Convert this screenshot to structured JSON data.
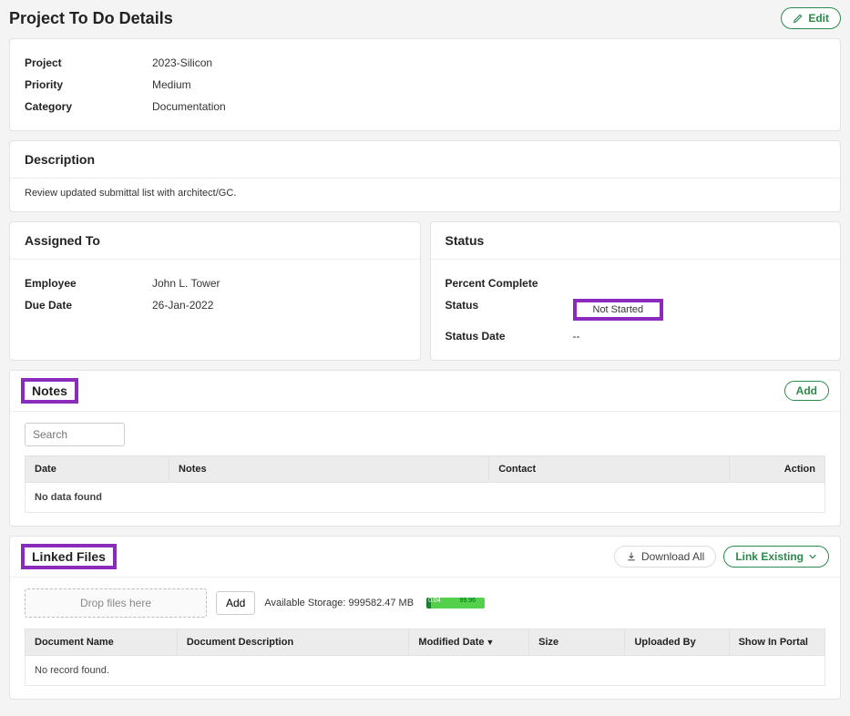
{
  "header": {
    "title": "Project To Do Details",
    "edit_label": "Edit"
  },
  "details": {
    "rows": [
      {
        "label": "Project",
        "value": "2023-Silicon"
      },
      {
        "label": "Priority",
        "value": "Medium"
      },
      {
        "label": "Category",
        "value": "Documentation"
      }
    ]
  },
  "description": {
    "heading": "Description",
    "text": "Review updated submittal list with architect/GC."
  },
  "assigned": {
    "heading": "Assigned To",
    "rows": [
      {
        "label": "Employee",
        "value": "John L. Tower"
      },
      {
        "label": "Due Date",
        "value": "26-Jan-2022"
      }
    ]
  },
  "status": {
    "heading": "Status",
    "rows": [
      {
        "label": "Percent Complete",
        "value": ""
      },
      {
        "label": "Status",
        "value": "Not Started"
      },
      {
        "label": "Status Date",
        "value": "--"
      }
    ]
  },
  "notes": {
    "heading": "Notes",
    "add_label": "Add",
    "search_placeholder": "Search",
    "columns": {
      "date": "Date",
      "notes": "Notes",
      "contact": "Contact",
      "action": "Action"
    },
    "empty": "No data found"
  },
  "linked": {
    "heading": "Linked Files",
    "download_label": "Download All",
    "link_existing_label": "Link Existing",
    "drop_text": "Drop files here",
    "add_label": "Add",
    "storage_label": "Available Storage: 999582.47 MB",
    "columns": {
      "name": "Document Name",
      "desc": "Document Description",
      "modified": "Modified Date",
      "size": "Size",
      "uploaded": "Uploaded By",
      "portal": "Show In Portal"
    },
    "empty": "No record found."
  }
}
